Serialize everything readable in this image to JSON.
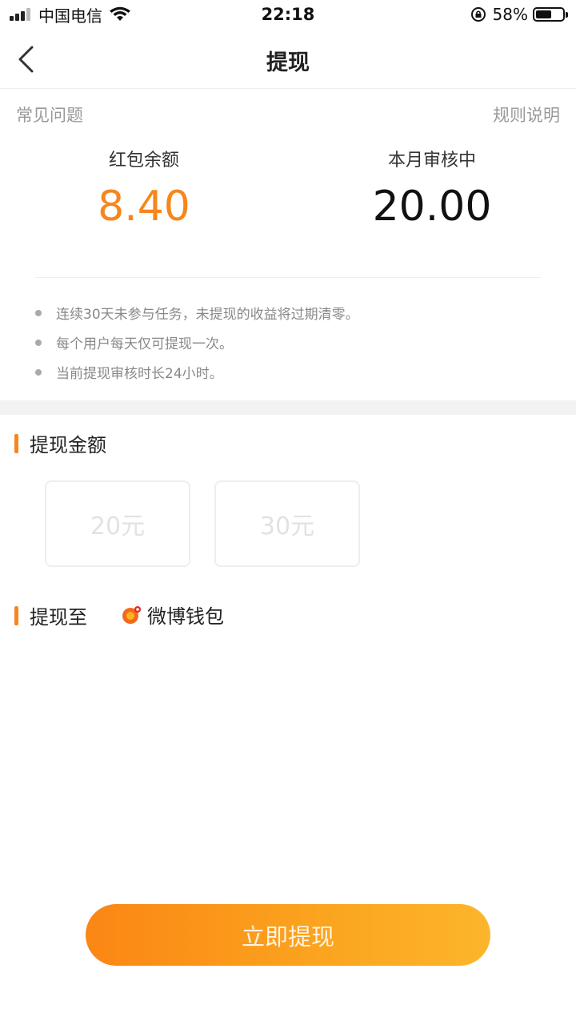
{
  "status_bar": {
    "carrier": "中国电信",
    "time": "22:18",
    "battery_percent": "58%",
    "battery_level": 0.58
  },
  "nav": {
    "title": "提现",
    "back_icon": "chevron-left-icon"
  },
  "links": {
    "faq": "常见问题",
    "rules": "规则说明"
  },
  "stats": {
    "balance_label": "红包余额",
    "balance_value": "8.40",
    "pending_label": "本月审核中",
    "pending_value": "20.00"
  },
  "notes": [
    "连续30天未参与任务，未提现的收益将过期清零。",
    "每个用户每天仅可提现一次。",
    "当前提现审核时长24小时。"
  ],
  "withdraw_amount": {
    "title": "提现金额",
    "options": [
      "20元",
      "30元"
    ]
  },
  "withdraw_to": {
    "title": "提现至",
    "wallet_name": "微博钱包",
    "wallet_icon": "weibo-wallet-icon"
  },
  "submit_label": "立即提现",
  "colors": {
    "accent": "#f7861c",
    "button_gradient_start": "#fb8614",
    "button_gradient_end": "#fcb52c"
  }
}
